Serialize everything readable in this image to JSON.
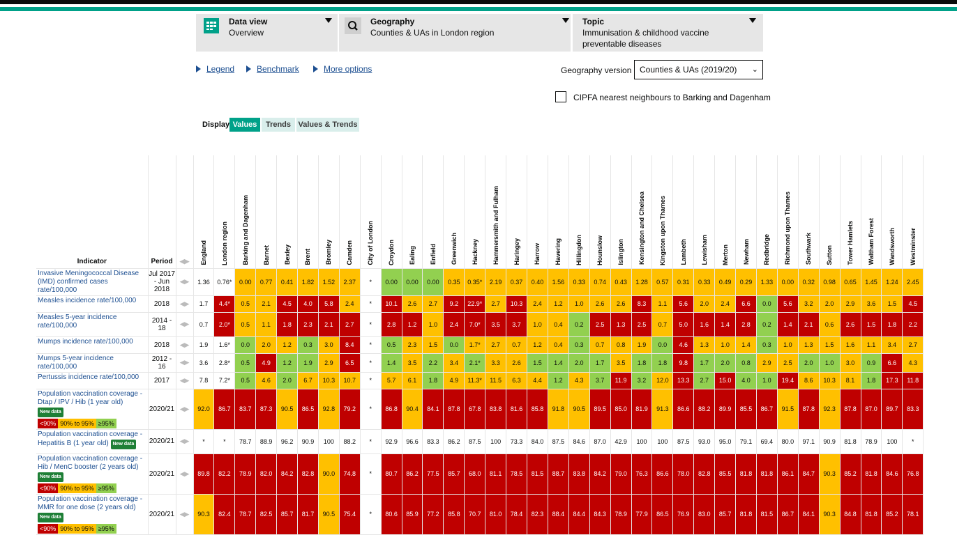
{
  "selectors": {
    "data_view": {
      "title": "Data view",
      "value": "Overview"
    },
    "geography": {
      "title": "Geography",
      "value": "Counties & UAs in London region"
    },
    "topic": {
      "title": "Topic",
      "value_line1": "Immunisation & childhood vaccine",
      "value_line2": "preventable diseases"
    }
  },
  "links": {
    "legend": "Legend",
    "benchmark": "Benchmark",
    "more_options": "More options"
  },
  "geography_version": {
    "label": "Geography version",
    "value": "Counties & UAs (2019/20)"
  },
  "cipfa": {
    "label": "CIPFA nearest neighbours to Barking and Dagenham"
  },
  "display": {
    "label": "Display",
    "values": "Values",
    "trends": "Trends",
    "values_trends": "Values & Trends"
  },
  "table": {
    "indicator_header": "Indicator",
    "period_header": "Period",
    "areas": [
      "England",
      "London region",
      "Barking and Dagenham",
      "Barnet",
      "Bexley",
      "Brent",
      "Bromley",
      "Camden",
      "City of London",
      "Croydon",
      "Ealing",
      "Enfield",
      "Greenwich",
      "Hackney",
      "Hammersmith and Fulham",
      "Haringey",
      "Harrow",
      "Havering",
      "Hillingdon",
      "Hounslow",
      "Islington",
      "Kensington and Chelsea",
      "Kingston upon Thames",
      "Lambeth",
      "Lewisham",
      "Merton",
      "Newham",
      "Redbridge",
      "Richmond upon Thames",
      "Southwark",
      "Sutton",
      "Tower Hamlets",
      "Waltham Forest",
      "Wandsworth",
      "Westminster"
    ],
    "new_data_label": "New data",
    "key_low": "<90%",
    "key_mid": "90% to 95%",
    "key_high": "≥95%",
    "rows": [
      {
        "indicator": "Invasive Meningococcal Disease (IMD) confirmed cases rate/100,000",
        "period": "Jul 2017 - Jun 2018",
        "badge": false,
        "keys": false,
        "values": [
          "1.36",
          "0.76*",
          "0.00",
          "0.77",
          "0.41",
          "1.82",
          "1.52",
          "2.37",
          "*",
          "0.00",
          "0.00",
          "0.00",
          "0.35",
          "0.35*",
          "2.19",
          "0.37",
          "0.40",
          "1.56",
          "0.33",
          "0.74",
          "0.43",
          "1.28",
          "0.57",
          "0.31",
          "0.33",
          "0.49",
          "0.29",
          "1.33",
          "0.00",
          "0.32",
          "0.98",
          "0.65",
          "1.45",
          "1.24",
          "2.45"
        ],
        "colors": [
          "N",
          "N",
          "Y",
          "Y",
          "Y",
          "Y",
          "Y",
          "Y",
          "N",
          "G",
          "G",
          "G",
          "Y",
          "Y",
          "Y",
          "Y",
          "Y",
          "Y",
          "Y",
          "Y",
          "Y",
          "Y",
          "Y",
          "Y",
          "Y",
          "Y",
          "Y",
          "Y",
          "Y",
          "Y",
          "Y",
          "Y",
          "Y",
          "Y",
          "Y"
        ]
      },
      {
        "indicator": "Measles incidence rate/100,000",
        "period": "2018",
        "badge": false,
        "keys": false,
        "values": [
          "1.7",
          "4.4*",
          "0.5",
          "2.1",
          "4.5",
          "4.0",
          "5.8",
          "2.4",
          "*",
          "10.1",
          "2.6",
          "2.7",
          "9.2",
          "22.9*",
          "2.7",
          "10.3",
          "2.4",
          "1.2",
          "1.0",
          "2.6",
          "2.6",
          "8.3",
          "1.1",
          "5.6",
          "2.0",
          "2.4",
          "6.6",
          "0.0",
          "5.6",
          "3.2",
          "2.0",
          "2.9",
          "3.6",
          "1.5",
          "4.5"
        ],
        "colors": [
          "N",
          "R",
          "Y",
          "Y",
          "R",
          "R",
          "R",
          "Y",
          "N",
          "R",
          "Y",
          "Y",
          "R",
          "R",
          "Y",
          "R",
          "Y",
          "Y",
          "Y",
          "Y",
          "Y",
          "R",
          "Y",
          "R",
          "Y",
          "Y",
          "R",
          "G",
          "R",
          "Y",
          "Y",
          "Y",
          "Y",
          "Y",
          "R"
        ]
      },
      {
        "indicator": "Measles 5-year incidence rate/100,000",
        "period": "2014 - 18",
        "badge": false,
        "keys": false,
        "values": [
          "0.7",
          "2.0*",
          "0.5",
          "1.1",
          "1.8",
          "2.3",
          "2.1",
          "2.7",
          "*",
          "2.8",
          "1.2",
          "1.0",
          "2.4",
          "7.0*",
          "3.5",
          "3.7",
          "1.0",
          "0.4",
          "0.2",
          "2.5",
          "1.3",
          "2.5",
          "0.7",
          "5.0",
          "1.6",
          "1.4",
          "2.8",
          "0.2",
          "1.4",
          "2.1",
          "0.6",
          "2.6",
          "1.5",
          "1.8",
          "2.2"
        ],
        "colors": [
          "N",
          "R",
          "Y",
          "Y",
          "R",
          "R",
          "R",
          "R",
          "N",
          "R",
          "R",
          "Y",
          "R",
          "R",
          "R",
          "R",
          "Y",
          "Y",
          "G",
          "R",
          "R",
          "R",
          "Y",
          "R",
          "R",
          "R",
          "R",
          "G",
          "R",
          "R",
          "Y",
          "R",
          "R",
          "R",
          "R"
        ]
      },
      {
        "indicator": "Mumps incidence rate/100,000",
        "period": "2018",
        "badge": false,
        "keys": false,
        "values": [
          "1.9",
          "1.6*",
          "0.0",
          "2.0",
          "1.2",
          "0.3",
          "3.0",
          "8.4",
          "*",
          "0.5",
          "2.3",
          "1.5",
          "0.0",
          "1.7*",
          "2.7",
          "0.7",
          "1.2",
          "0.4",
          "0.3",
          "0.7",
          "0.8",
          "1.9",
          "0.0",
          "4.6",
          "1.3",
          "1.0",
          "1.4",
          "0.3",
          "1.0",
          "1.3",
          "1.5",
          "1.6",
          "1.1",
          "3.4",
          "2.7"
        ],
        "colors": [
          "N",
          "N",
          "G",
          "Y",
          "Y",
          "G",
          "Y",
          "R",
          "N",
          "G",
          "Y",
          "Y",
          "G",
          "Y",
          "Y",
          "Y",
          "Y",
          "Y",
          "G",
          "Y",
          "Y",
          "Y",
          "G",
          "R",
          "Y",
          "Y",
          "Y",
          "G",
          "Y",
          "Y",
          "Y",
          "Y",
          "Y",
          "Y",
          "Y"
        ]
      },
      {
        "indicator": "Mumps 5-year incidence rate/100,000",
        "period": "2012 - 16",
        "badge": false,
        "keys": false,
        "values": [
          "3.6",
          "2.8*",
          "0.5",
          "4.9",
          "1.2",
          "1.9",
          "2.9",
          "6.5",
          "*",
          "1.4",
          "3.5",
          "2.2",
          "3.4",
          "2.1*",
          "3.3",
          "2.6",
          "1.5",
          "1.4",
          "2.0",
          "1.7",
          "3.5",
          "1.8",
          "1.8",
          "9.8",
          "1.7",
          "2.0",
          "0.8",
          "2.9",
          "2.5",
          "2.0",
          "1.0",
          "3.0",
          "0.9",
          "6.6",
          "4.3"
        ],
        "colors": [
          "N",
          "N",
          "G",
          "R",
          "G",
          "G",
          "Y",
          "R",
          "N",
          "G",
          "Y",
          "G",
          "Y",
          "G",
          "Y",
          "Y",
          "G",
          "G",
          "G",
          "G",
          "Y",
          "G",
          "G",
          "R",
          "G",
          "G",
          "G",
          "Y",
          "Y",
          "G",
          "G",
          "Y",
          "G",
          "R",
          "Y"
        ]
      },
      {
        "indicator": "Pertussis incidence rate/100,000",
        "period": "2017",
        "badge": false,
        "keys": false,
        "values": [
          "7.8",
          "7.2*",
          "0.5",
          "4.6",
          "2.0",
          "6.7",
          "10.3",
          "10.7",
          "*",
          "5.7",
          "6.1",
          "1.8",
          "4.9",
          "11.3*",
          "11.5",
          "6.3",
          "4.4",
          "1.2",
          "4.3",
          "3.7",
          "11.9",
          "3.2",
          "12.0",
          "13.3",
          "2.7",
          "15.0",
          "4.0",
          "1.0",
          "19.4",
          "8.6",
          "10.3",
          "8.1",
          "1.8",
          "17.3",
          "11.8"
        ],
        "colors": [
          "N",
          "N",
          "G",
          "Y",
          "G",
          "Y",
          "Y",
          "Y",
          "N",
          "Y",
          "Y",
          "G",
          "Y",
          "Y",
          "Y",
          "Y",
          "Y",
          "G",
          "Y",
          "G",
          "R",
          "G",
          "Y",
          "R",
          "G",
          "R",
          "G",
          "G",
          "R",
          "Y",
          "Y",
          "Y",
          "G",
          "R",
          "R"
        ]
      },
      {
        "indicator": "Population vaccination coverage - Dtap / IPV / Hib (1 year old)",
        "period": "2020/21",
        "badge": true,
        "keys": true,
        "values": [
          "92.0",
          "86.7",
          "83.7",
          "87.3",
          "90.5",
          "86.5",
          "92.8",
          "79.2",
          "*",
          "86.8",
          "90.4",
          "84.1",
          "87.8",
          "67.8",
          "83.8",
          "81.6",
          "85.8",
          "91.8",
          "90.5",
          "89.5",
          "85.0",
          "81.9",
          "91.3",
          "86.6",
          "88.2",
          "89.9",
          "85.5",
          "86.7",
          "91.5",
          "87.8",
          "92.3",
          "87.8",
          "87.0",
          "89.7",
          "83.3"
        ],
        "colors": [
          "O",
          "R",
          "R",
          "R",
          "O",
          "R",
          "O",
          "R",
          "N",
          "R",
          "O",
          "R",
          "R",
          "R",
          "R",
          "R",
          "R",
          "O",
          "O",
          "R",
          "R",
          "R",
          "O",
          "R",
          "R",
          "R",
          "R",
          "R",
          "O",
          "R",
          "O",
          "R",
          "R",
          "R",
          "R"
        ]
      },
      {
        "indicator": "Population vaccination coverage - Hepatitis B (1 year old)",
        "period": "2020/21",
        "badge": true,
        "keys": false,
        "values": [
          "*",
          "*",
          "78.7",
          "88.9",
          "96.2",
          "90.9",
          "100",
          "88.2",
          "*",
          "92.9",
          "96.6",
          "83.3",
          "86.2",
          "87.5",
          "100",
          "73.3",
          "84.0",
          "87.5",
          "84.6",
          "87.0",
          "42.9",
          "100",
          "100",
          "87.5",
          "93.0",
          "95.0",
          "79.1",
          "69.4",
          "80.0",
          "97.1",
          "90.9",
          "81.8",
          "78.9",
          "100",
          "*"
        ],
        "colors": [
          "N",
          "N",
          "N",
          "N",
          "N",
          "N",
          "N",
          "N",
          "N",
          "N",
          "N",
          "N",
          "N",
          "N",
          "N",
          "N",
          "N",
          "N",
          "N",
          "N",
          "N",
          "N",
          "N",
          "N",
          "N",
          "N",
          "N",
          "N",
          "N",
          "N",
          "N",
          "N",
          "N",
          "N",
          "N"
        ]
      },
      {
        "indicator": "Population vaccination coverage - Hib / MenC booster (2 years old)",
        "period": "2020/21",
        "badge": true,
        "keys": true,
        "values": [
          "89.8",
          "82.2",
          "78.9",
          "82.0",
          "84.2",
          "82.8",
          "90.0",
          "74.8",
          "*",
          "80.7",
          "86.2",
          "77.5",
          "85.7",
          "68.0",
          "81.1",
          "78.5",
          "81.5",
          "88.7",
          "83.8",
          "84.2",
          "79.0",
          "76.3",
          "86.6",
          "78.0",
          "82.8",
          "85.5",
          "81.8",
          "81.8",
          "86.1",
          "84.7",
          "90.3",
          "85.2",
          "81.8",
          "84.6",
          "76.8"
        ],
        "colors": [
          "R",
          "R",
          "R",
          "R",
          "R",
          "R",
          "O",
          "R",
          "N",
          "R",
          "R",
          "R",
          "R",
          "R",
          "R",
          "R",
          "R",
          "R",
          "R",
          "R",
          "R",
          "R",
          "R",
          "R",
          "R",
          "R",
          "R",
          "R",
          "R",
          "R",
          "O",
          "R",
          "R",
          "R",
          "R"
        ]
      },
      {
        "indicator": "Population vaccination coverage - MMR for one dose (2 years old)",
        "period": "2020/21",
        "badge": true,
        "keys": true,
        "values": [
          "90.3",
          "82.4",
          "78.7",
          "82.5",
          "85.7",
          "81.7",
          "90.5",
          "75.4",
          "*",
          "80.6",
          "85.9",
          "77.2",
          "85.8",
          "70.7",
          "81.0",
          "78.4",
          "82.3",
          "88.4",
          "84.4",
          "84.3",
          "78.9",
          "77.9",
          "86.5",
          "76.9",
          "83.0",
          "85.7",
          "81.8",
          "81.5",
          "86.7",
          "84.1",
          "90.3",
          "84.8",
          "81.8",
          "85.2",
          "78.1"
        ],
        "colors": [
          "O",
          "R",
          "R",
          "R",
          "R",
          "R",
          "O",
          "R",
          "N",
          "R",
          "R",
          "R",
          "R",
          "R",
          "R",
          "R",
          "R",
          "R",
          "R",
          "R",
          "R",
          "R",
          "R",
          "R",
          "R",
          "R",
          "R",
          "R",
          "R",
          "R",
          "O",
          "R",
          "R",
          "R",
          "R"
        ]
      }
    ]
  },
  "colors": {
    "teal": "#00a189",
    "red": "#bf0000",
    "amber": "#ffc000",
    "green": "#92d050",
    "link": "#1d4f91",
    "badge": "#1e7f36"
  },
  "icons": {
    "data_view": "grid-icon",
    "geography": "search-icon"
  }
}
